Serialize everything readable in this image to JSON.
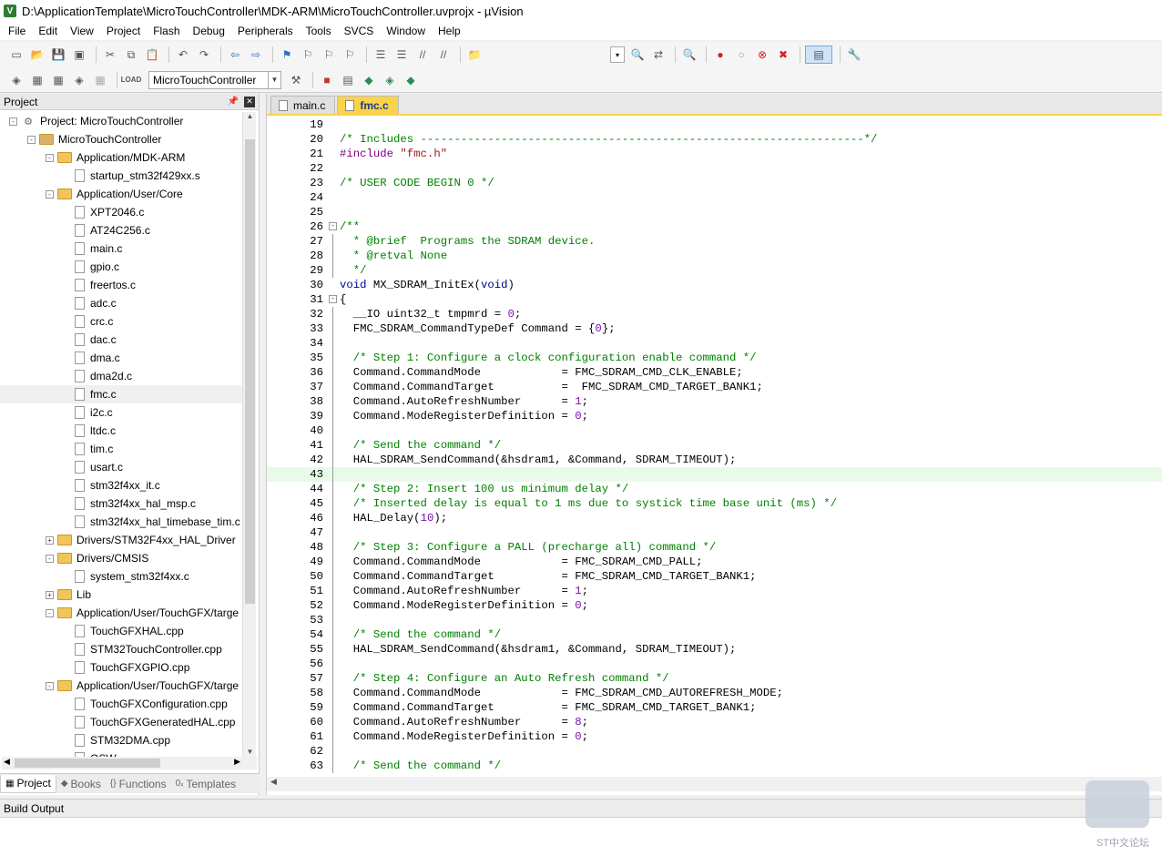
{
  "window": {
    "title": "D:\\ApplicationTemplate\\MicroTouchController\\MDK-ARM\\MicroTouchController.uvprojx - µVision"
  },
  "menu": [
    "File",
    "Edit",
    "View",
    "Project",
    "Flash",
    "Debug",
    "Peripherals",
    "Tools",
    "SVCS",
    "Window",
    "Help"
  ],
  "toolbar2": {
    "target": "MicroTouchController"
  },
  "project_panel": {
    "title": "Project",
    "tree": [
      {
        "level": 0,
        "type": "project",
        "expander": "-",
        "label": "Project: MicroTouchController"
      },
      {
        "level": 1,
        "type": "target",
        "expander": "-",
        "label": "MicroTouchController"
      },
      {
        "level": 2,
        "type": "folder",
        "expander": "-",
        "label": "Application/MDK-ARM"
      },
      {
        "level": 3,
        "type": "file",
        "label": "startup_stm32f429xx.s"
      },
      {
        "level": 2,
        "type": "folder",
        "expander": "-",
        "label": "Application/User/Core"
      },
      {
        "level": 3,
        "type": "file",
        "label": "XPT2046.c"
      },
      {
        "level": 3,
        "type": "file",
        "label": "AT24C256.c"
      },
      {
        "level": 3,
        "type": "file",
        "label": "main.c"
      },
      {
        "level": 3,
        "type": "file",
        "label": "gpio.c"
      },
      {
        "level": 3,
        "type": "file",
        "label": "freertos.c"
      },
      {
        "level": 3,
        "type": "file",
        "label": "adc.c"
      },
      {
        "level": 3,
        "type": "file",
        "label": "crc.c"
      },
      {
        "level": 3,
        "type": "file",
        "label": "dac.c"
      },
      {
        "level": 3,
        "type": "file",
        "label": "dma.c"
      },
      {
        "level": 3,
        "type": "file",
        "label": "dma2d.c"
      },
      {
        "level": 3,
        "type": "file",
        "label": "fmc.c",
        "selected": true
      },
      {
        "level": 3,
        "type": "file",
        "label": "i2c.c"
      },
      {
        "level": 3,
        "type": "file",
        "label": "ltdc.c"
      },
      {
        "level": 3,
        "type": "file",
        "label": "tim.c"
      },
      {
        "level": 3,
        "type": "file",
        "label": "usart.c"
      },
      {
        "level": 3,
        "type": "file",
        "label": "stm32f4xx_it.c"
      },
      {
        "level": 3,
        "type": "file",
        "label": "stm32f4xx_hal_msp.c"
      },
      {
        "level": 3,
        "type": "file",
        "label": "stm32f4xx_hal_timebase_tim.c"
      },
      {
        "level": 2,
        "type": "folder",
        "expander": "+",
        "label": "Drivers/STM32F4xx_HAL_Driver"
      },
      {
        "level": 2,
        "type": "folder",
        "expander": "-",
        "label": "Drivers/CMSIS"
      },
      {
        "level": 3,
        "type": "file",
        "label": "system_stm32f4xx.c"
      },
      {
        "level": 2,
        "type": "folder",
        "expander": "+",
        "label": "Lib"
      },
      {
        "level": 2,
        "type": "folder",
        "expander": "-",
        "label": "Application/User/TouchGFX/targe"
      },
      {
        "level": 3,
        "type": "file",
        "label": "TouchGFXHAL.cpp"
      },
      {
        "level": 3,
        "type": "file",
        "label": "STM32TouchController.cpp"
      },
      {
        "level": 3,
        "type": "file",
        "label": "TouchGFXGPIO.cpp"
      },
      {
        "level": 2,
        "type": "folder",
        "expander": "-",
        "label": "Application/User/TouchGFX/targe"
      },
      {
        "level": 3,
        "type": "file",
        "label": "TouchGFXConfiguration.cpp"
      },
      {
        "level": 3,
        "type": "file",
        "label": "TouchGFXGeneratedHAL.cpp"
      },
      {
        "level": 3,
        "type": "file",
        "label": "STM32DMA.cpp"
      },
      {
        "level": 3,
        "type": "file",
        "label": "OSW"
      }
    ],
    "tabs": [
      {
        "label": "Project",
        "icon": "project-icon",
        "active": true
      },
      {
        "label": "Books",
        "icon": "books-icon"
      },
      {
        "label": "Functions",
        "icon": "functions-icon",
        "glyph": "{}"
      },
      {
        "label": "Templates",
        "icon": "templates-icon",
        "glyph": "0ₓ"
      }
    ]
  },
  "editor": {
    "tabs": [
      {
        "label": "main.c",
        "active": false
      },
      {
        "label": "fmc.c",
        "active": true
      }
    ],
    "lines": [
      {
        "n": "19",
        "t": ""
      },
      {
        "n": "20",
        "t": "/* Includes ------------------------------------------------------------------*/",
        "c": "com"
      },
      {
        "n": "21",
        "t": "#include \"fmc.h\"",
        "c": "pp"
      },
      {
        "n": "22",
        "t": ""
      },
      {
        "n": "23",
        "t": "/* USER CODE BEGIN 0 */",
        "c": "com"
      },
      {
        "n": "24",
        "t": ""
      },
      {
        "n": "25",
        "t": ""
      },
      {
        "n": "26",
        "t": "/**",
        "c": "com",
        "fold": "-"
      },
      {
        "n": "27",
        "t": "  * @brief  Programs the SDRAM device.",
        "c": "com",
        "bar": true
      },
      {
        "n": "28",
        "t": "  * @retval None",
        "c": "com",
        "bar": true
      },
      {
        "n": "29",
        "t": "  */",
        "c": "com",
        "bar": true
      },
      {
        "n": "30",
        "t": "void MX_SDRAM_InitEx(void)",
        "c": "fn"
      },
      {
        "n": "31",
        "t": "{",
        "fold": "-"
      },
      {
        "n": "32",
        "t": "  __IO uint32_t tmpmrd = 0;",
        "c": "decl",
        "bar": true
      },
      {
        "n": "33",
        "t": "  FMC_SDRAM_CommandTypeDef Command = {0};",
        "c": "decl2",
        "bar": true
      },
      {
        "n": "34",
        "t": "",
        "bar": true
      },
      {
        "n": "35",
        "t": "  /* Step 1: Configure a clock configuration enable command */",
        "c": "com",
        "bar": true
      },
      {
        "n": "36",
        "t": "  Command.CommandMode            = FMC_SDRAM_CMD_CLK_ENABLE;",
        "bar": true
      },
      {
        "n": "37",
        "t": "  Command.CommandTarget          =  FMC_SDRAM_CMD_TARGET_BANK1;",
        "bar": true
      },
      {
        "n": "38",
        "t": "  Command.AutoRefreshNumber      = 1;",
        "c": "num",
        "bar": true
      },
      {
        "n": "39",
        "t": "  Command.ModeRegisterDefinition = 0;",
        "c": "num",
        "bar": true
      },
      {
        "n": "40",
        "t": "",
        "bar": true
      },
      {
        "n": "41",
        "t": "  /* Send the command */",
        "c": "com",
        "bar": true
      },
      {
        "n": "42",
        "t": "  HAL_SDRAM_SendCommand(&hsdram1, &Command, SDRAM_TIMEOUT);",
        "bar": true
      },
      {
        "n": "43",
        "t": "",
        "hl": true,
        "bar": true
      },
      {
        "n": "44",
        "t": "  /* Step 2: Insert 100 us minimum delay */",
        "c": "com",
        "bar": true
      },
      {
        "n": "45",
        "t": "  /* Inserted delay is equal to 1 ms due to systick time base unit (ms) */",
        "c": "com",
        "bar": true
      },
      {
        "n": "46",
        "t": "  HAL_Delay(10);",
        "c": "num",
        "bar": true
      },
      {
        "n": "47",
        "t": "",
        "bar": true
      },
      {
        "n": "48",
        "t": "  /* Step 3: Configure a PALL (precharge all) command */",
        "c": "com",
        "bar": true
      },
      {
        "n": "49",
        "t": "  Command.CommandMode            = FMC_SDRAM_CMD_PALL;",
        "bar": true
      },
      {
        "n": "50",
        "t": "  Command.CommandTarget          = FMC_SDRAM_CMD_TARGET_BANK1;",
        "bar": true
      },
      {
        "n": "51",
        "t": "  Command.AutoRefreshNumber      = 1;",
        "c": "num",
        "bar": true
      },
      {
        "n": "52",
        "t": "  Command.ModeRegisterDefinition = 0;",
        "c": "num",
        "bar": true
      },
      {
        "n": "53",
        "t": "",
        "bar": true
      },
      {
        "n": "54",
        "t": "  /* Send the command */",
        "c": "com",
        "bar": true
      },
      {
        "n": "55",
        "t": "  HAL_SDRAM_SendCommand(&hsdram1, &Command, SDRAM_TIMEOUT);",
        "bar": true
      },
      {
        "n": "56",
        "t": "",
        "bar": true
      },
      {
        "n": "57",
        "t": "  /* Step 4: Configure an Auto Refresh command */",
        "c": "com",
        "bar": true
      },
      {
        "n": "58",
        "t": "  Command.CommandMode            = FMC_SDRAM_CMD_AUTOREFRESH_MODE;",
        "bar": true
      },
      {
        "n": "59",
        "t": "  Command.CommandTarget          = FMC_SDRAM_CMD_TARGET_BANK1;",
        "bar": true
      },
      {
        "n": "60",
        "t": "  Command.AutoRefreshNumber      = 8;",
        "c": "num",
        "bar": true
      },
      {
        "n": "61",
        "t": "  Command.ModeRegisterDefinition = 0;",
        "c": "num",
        "bar": true
      },
      {
        "n": "62",
        "t": "",
        "bar": true
      },
      {
        "n": "63",
        "t": "  /* Send the command */",
        "c": "com",
        "bar": true
      }
    ]
  },
  "build_output": {
    "title": "Build Output"
  },
  "watermark": {
    "text": "ST中文论坛"
  },
  "colors": {
    "active_tab": "#f9d34b",
    "comment": "#008000",
    "keyword": "#00008b",
    "number": "#7a0fb0",
    "highlight_line": "#e8fbe8"
  }
}
